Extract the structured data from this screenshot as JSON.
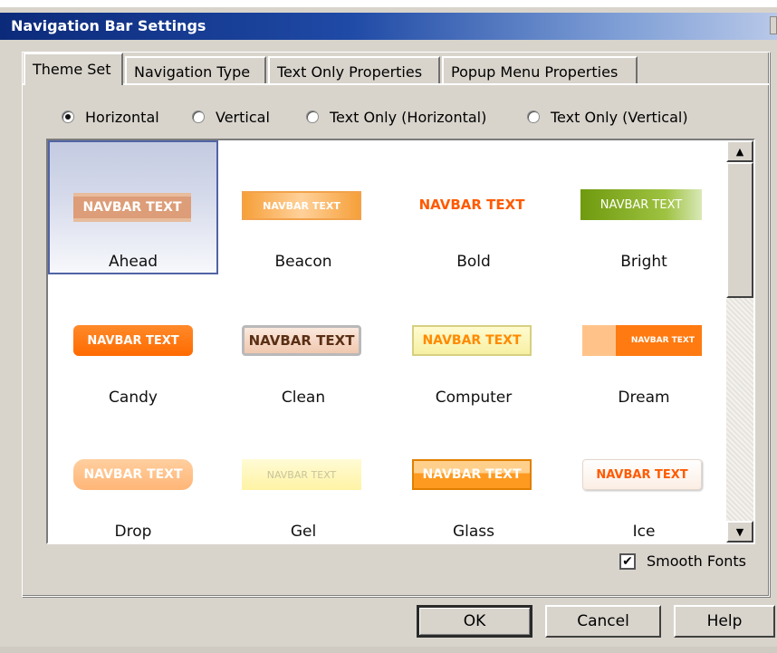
{
  "window": {
    "title": "Navigation Bar Settings",
    "accent": "#1f4aa6"
  },
  "tabs": [
    {
      "label": "Theme Set",
      "active": true
    },
    {
      "label": "Navigation Type"
    },
    {
      "label": "Text Only Properties"
    },
    {
      "label": "Popup Menu Properties"
    }
  ],
  "orientation": {
    "options": [
      {
        "label": "Horizontal",
        "checked": true
      },
      {
        "label": "Vertical"
      },
      {
        "label": "Text Only (Horizontal)"
      },
      {
        "label": "Text Only (Vertical)"
      }
    ]
  },
  "themes": [
    {
      "name": "Ahead",
      "preview_text": "NAVBAR TEXT",
      "selected": true
    },
    {
      "name": "Beacon",
      "preview_text": "NAVBAR TEXT"
    },
    {
      "name": "Bold",
      "preview_text": "NAVBAR TEXT"
    },
    {
      "name": "Bright",
      "preview_text": "NAVBAR TEXT"
    },
    {
      "name": "Candy",
      "preview_text": "NAVBAR TEXT"
    },
    {
      "name": "Clean",
      "preview_text": "NAVBAR TEXT"
    },
    {
      "name": "Computer",
      "preview_text": "NAVBAR TEXT"
    },
    {
      "name": "Dream",
      "preview_text": "NAVBAR TEXT"
    },
    {
      "name": "Drop",
      "preview_text": "NAVBAR TEXT"
    },
    {
      "name": "Gel",
      "preview_text": "NAVBAR TEXT"
    },
    {
      "name": "Glass",
      "preview_text": "NAVBAR TEXT"
    },
    {
      "name": "Ice",
      "preview_text": "NAVBAR TEXT"
    }
  ],
  "scrollbar": {
    "up_icon": "arrow-up-icon",
    "down_icon": "arrow-down-icon",
    "up_glyph": "▲",
    "down_glyph": "▼"
  },
  "smooth_fonts": {
    "label": "Smooth Fonts",
    "checked": true,
    "check_glyph": "✔"
  },
  "buttons": {
    "ok": "OK",
    "cancel": "Cancel",
    "help": "Help"
  }
}
